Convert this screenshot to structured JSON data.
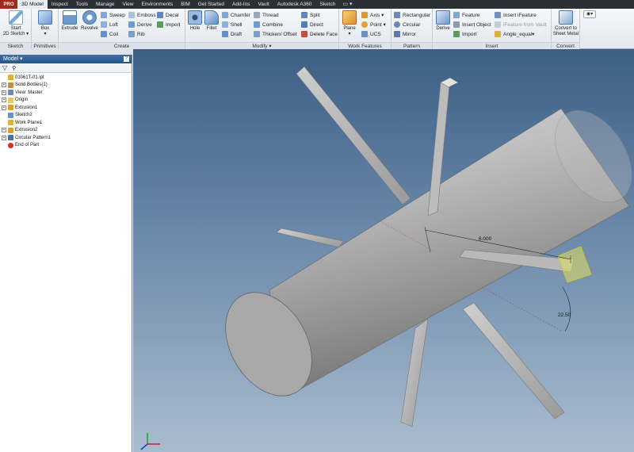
{
  "app_menu_label": "PRO",
  "tabs": [
    "3D Model",
    "Inspect",
    "Tools",
    "Manage",
    "View",
    "Environments",
    "BIM",
    "Get Started",
    "Add-Ins",
    "Vault",
    "Autodesk A360",
    "Sketch"
  ],
  "tab_extra": "▭ ▾",
  "ribbon": {
    "sketch": {
      "title": "Sketch",
      "start": "Start",
      "sketch2d": "2D Sketch ▾"
    },
    "primitives": {
      "title": "Primitives",
      "box": "Box"
    },
    "create": {
      "title": "Create",
      "extrude": "Extrude",
      "revolve": "Revolve",
      "sweep": "Sweep",
      "loft": "Loft",
      "coil": "Coil",
      "emboss": "Emboss",
      "derive": "Derive",
      "rib": "Rib",
      "decal": "Decal",
      "import": "Import"
    },
    "modify": {
      "title": "Modify ▾",
      "hole": "Hole",
      "fillet": "Fillet",
      "chamfer": "Chamfer",
      "shell": "Shell",
      "draft": "Draft",
      "thread": "Thread",
      "combine": "Combine",
      "thicken": "Thicken/ Offset",
      "split": "Split",
      "direct": "Direct",
      "delete_face": "Delete Face"
    },
    "work_features": {
      "title": "Work Features",
      "plane": "Plane",
      "axis": "Axis ▾",
      "point": "Point ▾",
      "ucs": "UCS"
    },
    "pattern": {
      "title": "Pattern",
      "rectangular": "Rectangular",
      "circular": "Circular",
      "mirror": "Mirror"
    },
    "insert": {
      "title": "Insert",
      "derive": "Derive",
      "feature": "Feature",
      "insert_object": "Insert Object",
      "import": "Import",
      "insert_ifeature": "Insert iFeature",
      "ifeature_vault": "iFeature from Vault",
      "angle_equal": "Angle_equal▾"
    },
    "convert": {
      "title": "Convert",
      "convert_label": "Convert to Sheet Metal"
    }
  },
  "browser": {
    "title": "Model ▾",
    "help": "?",
    "filter_icon": "▽",
    "find_icon": "🔭",
    "nodes": [
      {
        "label": "01061T-01.ipt",
        "exp": "",
        "indent": 0,
        "icon": "#e0b030"
      },
      {
        "label": "Solid Bodies(1)",
        "exp": "+",
        "indent": 1,
        "icon": "#c09040"
      },
      {
        "label": "View: Master",
        "exp": "+",
        "indent": 1,
        "icon": "#6a8ab0"
      },
      {
        "label": "Origin",
        "exp": "+",
        "indent": 1,
        "icon": "#e8c860"
      },
      {
        "label": "Extrusion1",
        "exp": "+",
        "indent": 1,
        "icon": "#d8a030"
      },
      {
        "label": "Sketch2",
        "exp": "",
        "indent": 1,
        "icon": "#7090c0"
      },
      {
        "label": "Work Plane1",
        "exp": "",
        "indent": 1,
        "icon": "#e0b040"
      },
      {
        "label": "Extrusion2",
        "exp": "+",
        "indent": 1,
        "icon": "#d8a030"
      },
      {
        "label": "Circular Pattern1",
        "exp": "+",
        "indent": 1,
        "icon": "#5070a0"
      },
      {
        "label": "End of Part",
        "exp": "",
        "indent": 1,
        "icon": "#d03020"
      }
    ]
  },
  "viewport": {
    "dimension_linear": "6.000",
    "dimension_angle": "22.50"
  },
  "colors": {
    "accent": "#3d6fa4",
    "app_button": "#a12a20",
    "selection": "#e0e060"
  }
}
